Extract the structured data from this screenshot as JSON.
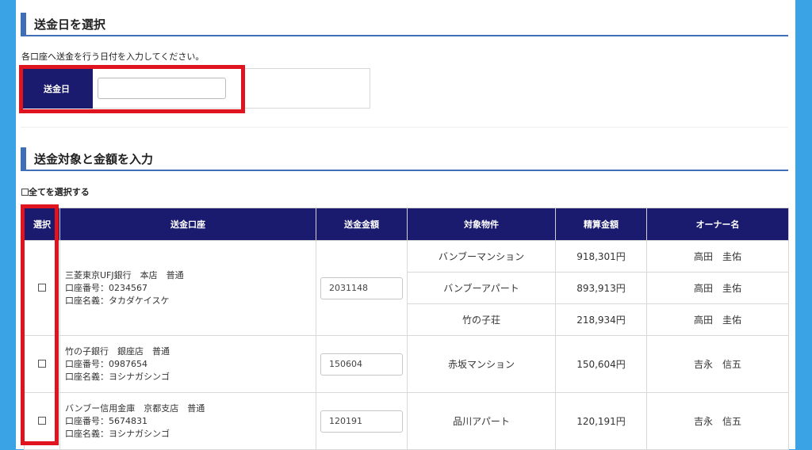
{
  "date_section": {
    "title": "送金日を選択",
    "note": "各口座へ送金を行う日付を入力してください。",
    "label": "送金日",
    "value": ""
  },
  "target_section": {
    "title": "送金対象と金額を入力",
    "select_all": "全てを選択する"
  },
  "table": {
    "headers": [
      "選択",
      "送金口座",
      "送金金額",
      "対象物件",
      "精算金額",
      "オーナー名"
    ],
    "accounts": [
      {
        "bank": "三菱東京UFJ銀行　本店　普通",
        "number": "口座番号：0234567",
        "holder": "口座名義：タカダケイスケ",
        "amount": "2031148",
        "properties": [
          {
            "name": "バンブーマンション",
            "settle": "918,301円",
            "owner": "高田　圭佑"
          },
          {
            "name": "バンブーアパート",
            "settle": "893,913円",
            "owner": "高田　圭佑"
          },
          {
            "name": "竹の子荘",
            "settle": "218,934円",
            "owner": "高田　圭佑"
          }
        ]
      },
      {
        "bank": "竹の子銀行　銀座店　普通",
        "number": "口座番号：0987654",
        "holder": "口座名義：ヨシナガシンゴ",
        "amount": "150604",
        "properties": [
          {
            "name": "赤坂マンション",
            "settle": "150,604円",
            "owner": "吉永　信五"
          }
        ]
      },
      {
        "bank": "バンブー信用金庫　京都支店　普通",
        "number": "口座番号：5674831",
        "holder": "口座名義：ヨシナガシンゴ",
        "amount": "120191",
        "properties": [
          {
            "name": "品川アパート",
            "settle": "120,191円",
            "owner": "吉永　信五"
          }
        ]
      }
    ]
  }
}
